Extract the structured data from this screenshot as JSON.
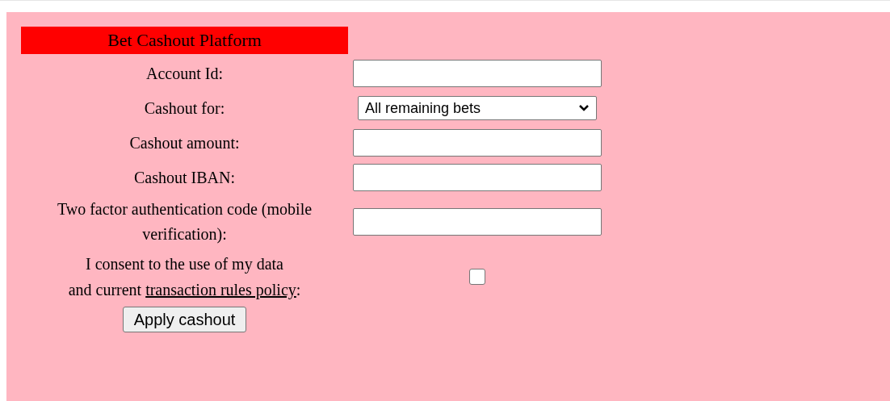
{
  "title": "Bet Cashout Platform",
  "fields": [
    {
      "kind": "text",
      "label": "Account Id:"
    },
    {
      "kind": "select",
      "label": "Cashout for:",
      "value": "All remaining bets"
    },
    {
      "kind": "text",
      "label": "Cashout amount:"
    },
    {
      "kind": "text",
      "label": "Cashout IBAN:"
    },
    {
      "kind": "text",
      "label": "Two factor authentication code (mobile verification):"
    },
    {
      "kind": "checkbox",
      "label_line_1": "I consent to the use of my data",
      "label_line_2": "and current ",
      "link": "transaction rules policy",
      "label_after": ":",
      "checked": false
    }
  ],
  "button": "Apply cashout"
}
